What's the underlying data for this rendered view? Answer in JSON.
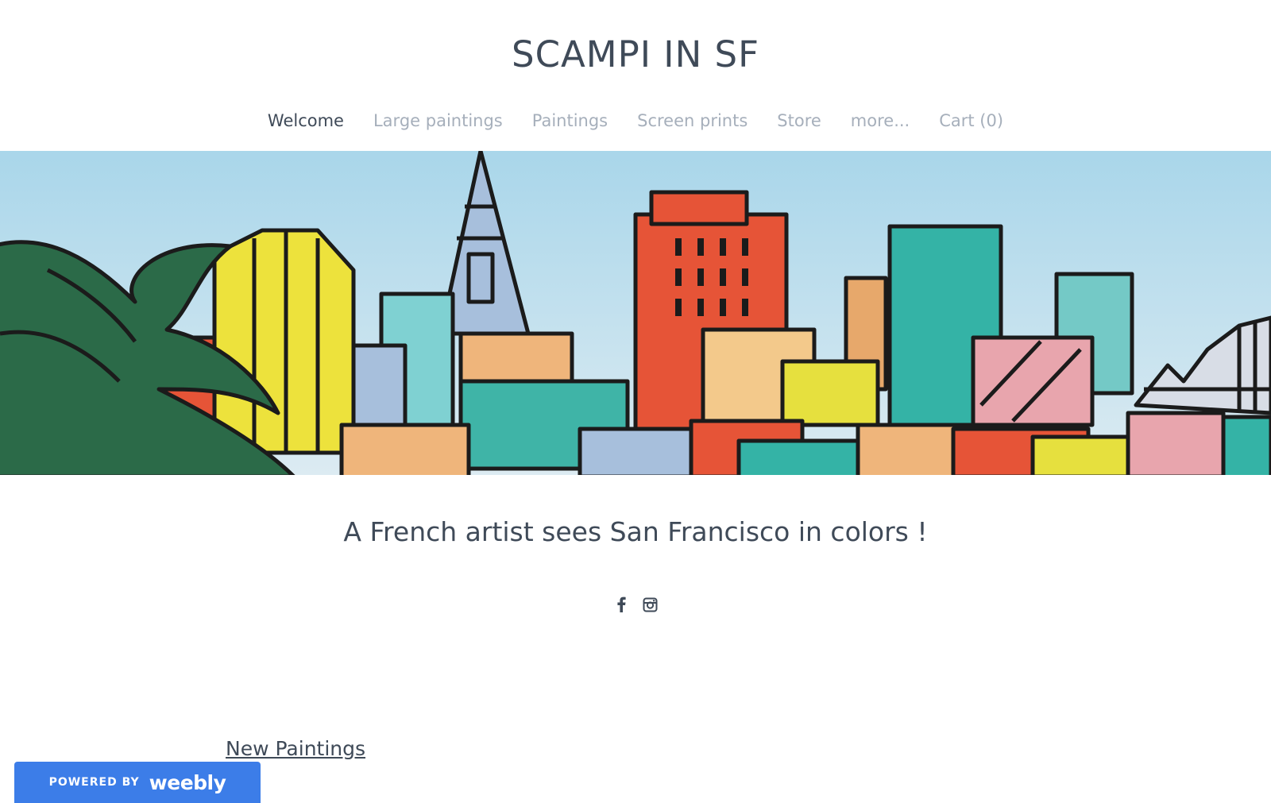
{
  "site": {
    "title": "SCAMPI IN SF"
  },
  "nav": {
    "items": [
      {
        "label": "Welcome",
        "active": true
      },
      {
        "label": "Large paintings"
      },
      {
        "label": "Paintings"
      },
      {
        "label": "Screen prints"
      },
      {
        "label": "Store"
      },
      {
        "label": "more..."
      },
      {
        "label": "Cart (0)"
      }
    ]
  },
  "main": {
    "tagline": "A French artist sees San Francisco in colors !",
    "section_link": "New Paintings"
  },
  "social": {
    "icons": [
      "facebook-icon",
      "instagram-icon"
    ]
  },
  "footer": {
    "powered_by": "POWERED BY",
    "brand": "weebly"
  },
  "colors": {
    "text": "#3f4a58",
    "nav_inactive": "#a6afbb",
    "badge": "#3c7de8"
  }
}
